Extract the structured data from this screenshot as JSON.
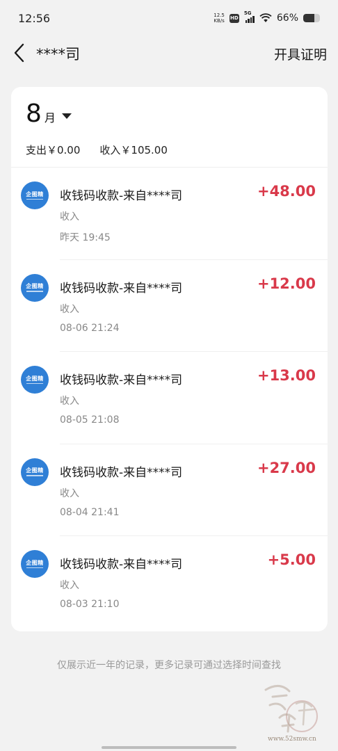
{
  "status_bar": {
    "time": "12:56",
    "net_speed_value": "12.5",
    "net_speed_unit": "KB/s",
    "hd": "HD",
    "network": "5G",
    "battery_percent": "66%",
    "battery_level": 0.66
  },
  "nav": {
    "title": "****司",
    "action": "开具证明"
  },
  "summary": {
    "month": "8",
    "month_unit": "月",
    "expense": "支出￥0.00",
    "income": "收入￥105.00"
  },
  "transactions": [
    {
      "title": "收钱码收款-来自****司",
      "type": "收入",
      "time": "昨天 19:45",
      "amount": "+48.00"
    },
    {
      "title": "收钱码收款-来自****司",
      "type": "收入",
      "time": "08-06 21:24",
      "amount": "+12.00"
    },
    {
      "title": "收钱码收款-来自****司",
      "type": "收入",
      "time": "08-05 21:08",
      "amount": "+13.00"
    },
    {
      "title": "收钱码收款-来自****司",
      "type": "收入",
      "time": "08-04 21:41",
      "amount": "+27.00"
    },
    {
      "title": "收钱码收款-来自****司",
      "type": "收入",
      "time": "08-03 21:10",
      "amount": "+5.00"
    }
  ],
  "avatar_logo_text": "企图精",
  "footer_note": "仅展示近一年的记录，更多记录可通过选择时间查找",
  "watermark": {
    "url": "www.52smw.cn"
  },
  "colors": {
    "amount": "#d9394a",
    "avatar": "#2f7fd6",
    "background": "#f2f2f2"
  }
}
